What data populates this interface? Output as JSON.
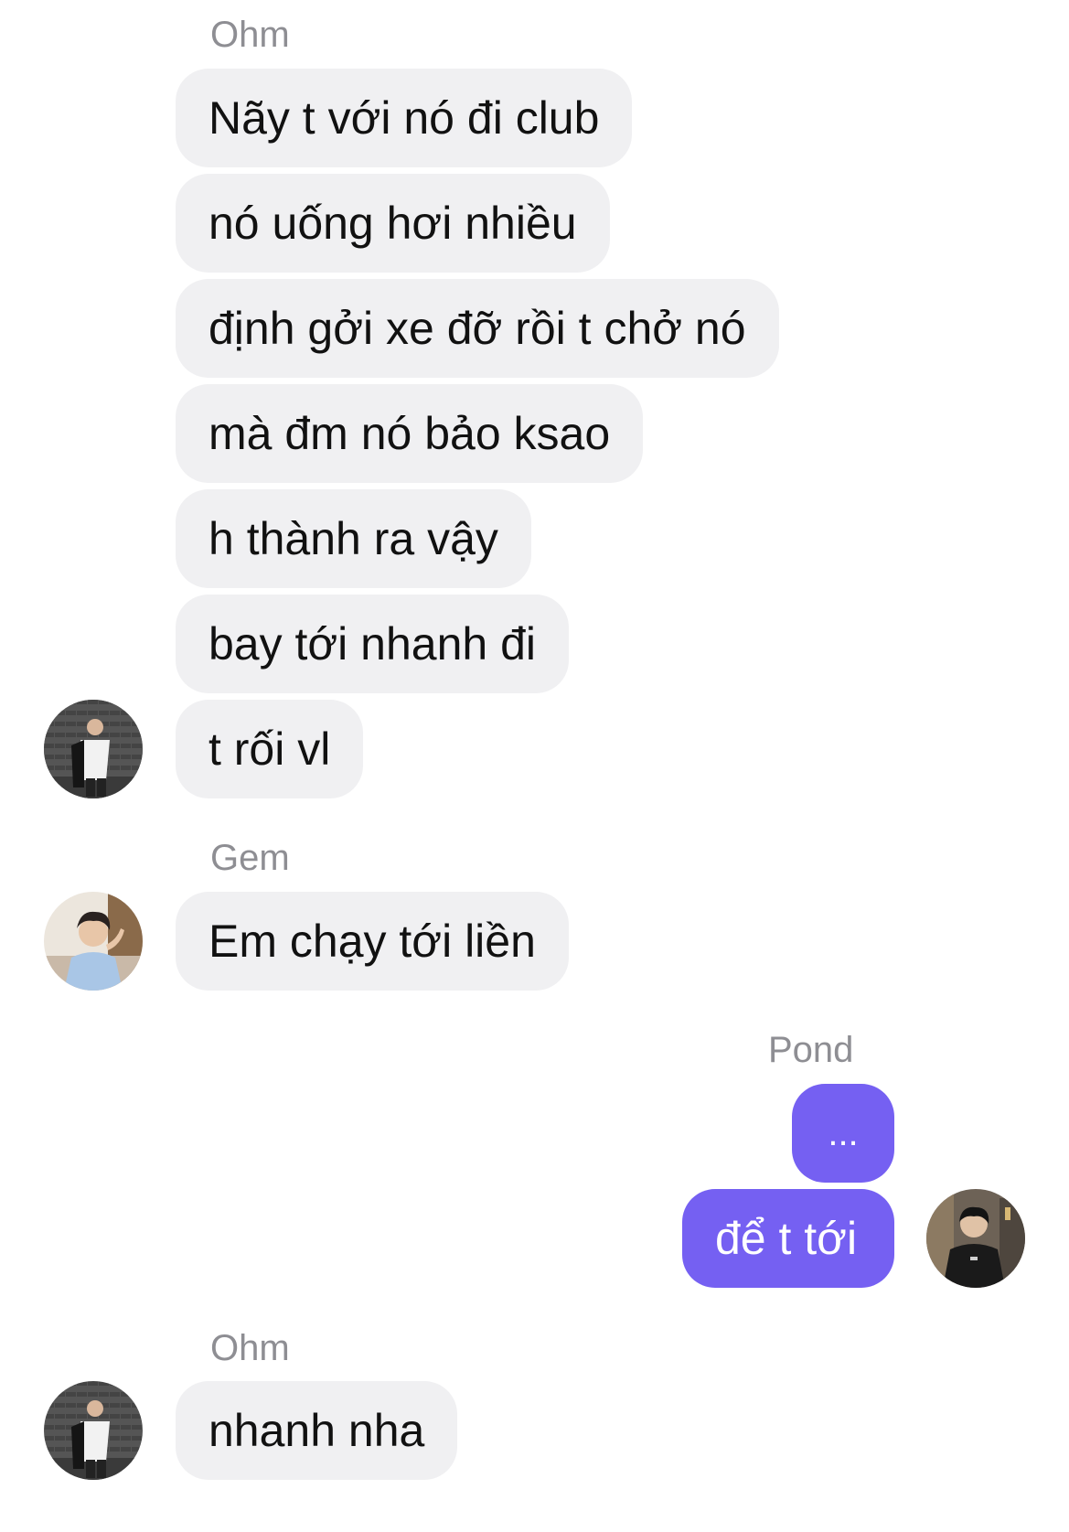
{
  "conversation": {
    "groups": [
      {
        "sender": "Ohm",
        "messages": [
          "Nãy t với nó đi club",
          "nó uống hơi nhiều",
          "định gởi xe đỡ rồi t chở nó",
          "mà đm nó bảo ksao",
          "h thành ra vậy",
          "bay tới nhanh đi",
          "t rối vl"
        ],
        "avatar_icon": "profile-photo-ohm"
      },
      {
        "sender": "Gem",
        "messages": [
          "Em chạy tới liền"
        ],
        "avatar_icon": "profile-photo-gem"
      },
      {
        "sender": "Pond",
        "messages": [
          "...",
          "để t tới"
        ],
        "avatar_icon": "profile-photo-pond"
      },
      {
        "sender": "Ohm",
        "messages": [
          "nhanh nha"
        ],
        "avatar_icon": "profile-photo-ohm"
      }
    ]
  },
  "colors": {
    "incoming_bubble": "#f0f0f2",
    "outgoing_bubble": "#7560f2",
    "sender_name": "#8e8e93"
  }
}
